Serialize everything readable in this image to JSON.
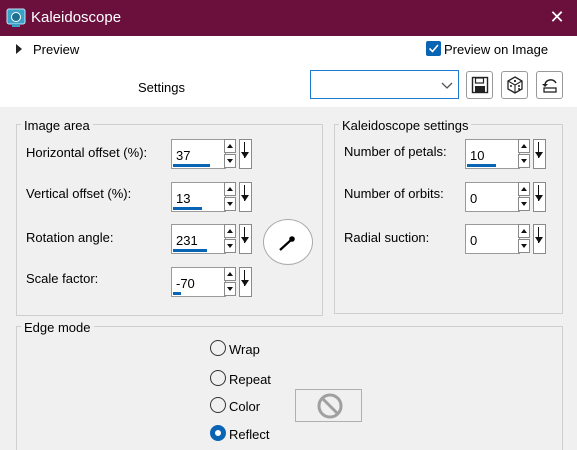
{
  "window": {
    "title": "Kaleidoscope",
    "close_symbol": "✕",
    "titlebar_color": "#6b0f3d",
    "accent_color": "#0a64b4"
  },
  "preview": {
    "label": "Preview",
    "preview_on_image_label": "Preview on Image",
    "preview_on_image_checked": true
  },
  "settings": {
    "label": "Settings",
    "dropdown_value": "",
    "buttons": [
      "save-icon",
      "randomize-dice-icon",
      "reset-icon"
    ]
  },
  "image_area": {
    "title": "Image area",
    "horizontal_offset": {
      "label": "Horizontal offset (%):",
      "value": "37",
      "level": 0.7
    },
    "vertical_offset": {
      "label": "Vertical offset (%):",
      "value": "13",
      "level": 0.55
    },
    "rotation_angle": {
      "label": "Rotation angle:",
      "value": "231",
      "level": 0.64
    },
    "scale_factor": {
      "label": "Scale factor:",
      "value": "-70",
      "level": 0.15
    }
  },
  "kaleidoscope_settings": {
    "title": "Kaleidoscope settings",
    "number_of_petals": {
      "label": "Number of petals:",
      "value": "10",
      "level": 0.55
    },
    "number_of_orbits": {
      "label": "Number of orbits:",
      "value": "0",
      "level": 0
    },
    "radial_suction": {
      "label": "Radial suction:",
      "value": "0",
      "level": 0
    }
  },
  "edge_mode": {
    "title": "Edge mode",
    "options": [
      {
        "label": "Wrap",
        "selected": false
      },
      {
        "label": "Repeat",
        "selected": false
      },
      {
        "label": "Color",
        "selected": false
      },
      {
        "label": "Reflect",
        "selected": true
      }
    ]
  }
}
